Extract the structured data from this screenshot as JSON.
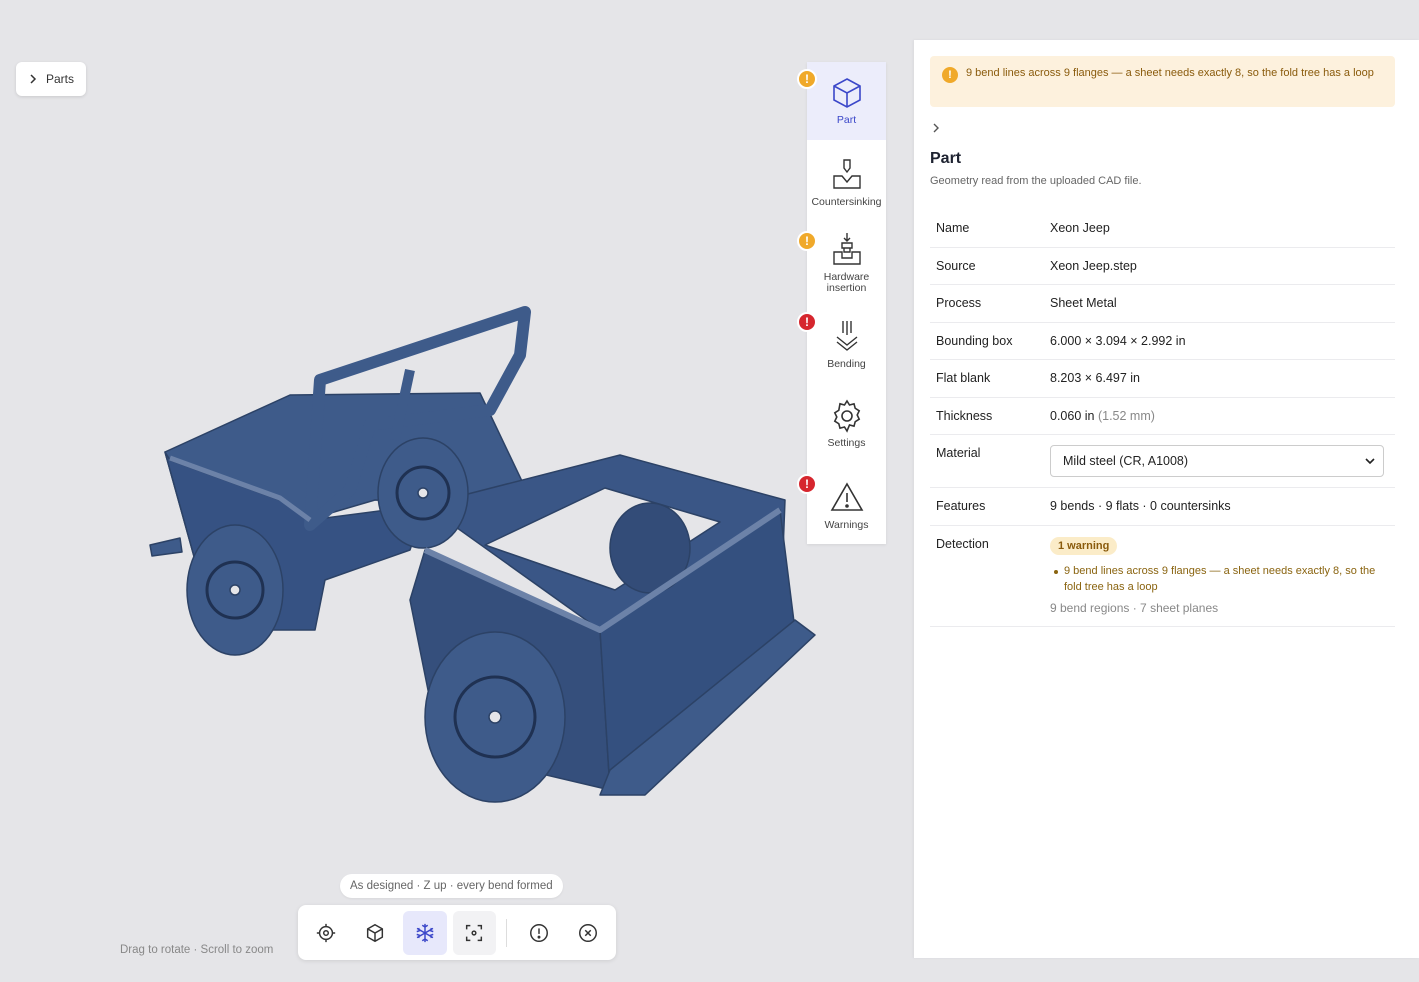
{
  "parts_button": {
    "label": "Parts"
  },
  "viewport": {
    "caption": "As designed · Z up · every bend formed",
    "hint": "Drag to rotate · Scroll to zoom",
    "model_color": "#3e5b8a"
  },
  "toolbar": {
    "buttons": [
      {
        "icon": "target-icon",
        "state": "normal"
      },
      {
        "icon": "cube-icon",
        "state": "normal"
      },
      {
        "icon": "snowflake-icon",
        "state": "active"
      },
      {
        "icon": "frame-focus-icon",
        "state": "subtle"
      },
      {
        "icon": "alert-circle-icon",
        "state": "normal"
      },
      {
        "icon": "close-circle-icon",
        "state": "normal"
      }
    ]
  },
  "steps": [
    {
      "label": "Part",
      "icon": "cube-icon",
      "active": true,
      "badge": "warning"
    },
    {
      "label": "Countersinking",
      "icon": "countersink-icon",
      "active": false,
      "badge": null
    },
    {
      "label": "Hardware insertion",
      "icon": "hardware-insertion-icon",
      "active": false,
      "badge": "warning"
    },
    {
      "label": "Bending",
      "icon": "bending-icon",
      "active": false,
      "badge": "error"
    },
    {
      "label": "Settings",
      "icon": "gear-icon",
      "active": false,
      "badge": null
    },
    {
      "label": "Warnings",
      "icon": "warning-triangle-icon",
      "active": false,
      "badge": "error"
    }
  ],
  "panel": {
    "alert": "9 bend lines across 9 flanges — a sheet needs exactly 8, so the fold tree has a loop",
    "title": "Part",
    "subtitle": "Geometry read from the uploaded CAD file.",
    "properties": {
      "name": {
        "label": "Name",
        "value": "Xeon Jeep"
      },
      "source": {
        "label": "Source",
        "value": "Xeon Jeep.step"
      },
      "process": {
        "label": "Process",
        "value": "Sheet Metal"
      },
      "bbox": {
        "label": "Bounding box",
        "value": "6.000 × 3.094 × 2.992 in"
      },
      "flat": {
        "label": "Flat blank",
        "value": "8.203 × 6.497 in"
      },
      "thickness": {
        "label": "Thickness",
        "value": "0.060 in",
        "secondary": "(1.52 mm)"
      },
      "material": {
        "label": "Material",
        "value": "Mild steel (CR, A1008)"
      },
      "features": {
        "label": "Features",
        "value": "9 bends · 9 flats · 0 countersinks"
      },
      "detection": {
        "label": "Detection",
        "badge": "1 warning",
        "items": [
          "9 bend lines across 9 flanges — a sheet needs exactly 8, so the fold tree has a loop"
        ],
        "footer": "9 bend regions · 7 sheet planes"
      }
    }
  },
  "colors": {
    "accent": "#3b47c9",
    "warning": "#f0a92a",
    "error": "#d6262e",
    "background": "#e5e5e8"
  }
}
